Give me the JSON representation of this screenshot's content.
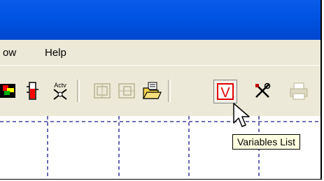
{
  "menu": {
    "items": [
      "ow",
      "Help"
    ]
  },
  "toolbar": {
    "buttons": [
      {
        "name": "color-tool-icon"
      },
      {
        "name": "level-indicator-icon"
      },
      {
        "name": "activex-icon",
        "label": "Actv"
      },
      {
        "name": "group-icon"
      },
      {
        "name": "ungroup-icon"
      },
      {
        "name": "open-folder-icon"
      },
      {
        "name": "variables-list-icon",
        "label": "V"
      },
      {
        "name": "tools-icon"
      },
      {
        "name": "print-icon"
      }
    ]
  },
  "tooltip": {
    "text": "Variables List"
  },
  "colors": {
    "title_bar": "#0054e3",
    "menu_bg": "#ece9d8",
    "grid": "#1b1b8f",
    "v_red": "#e00000"
  }
}
